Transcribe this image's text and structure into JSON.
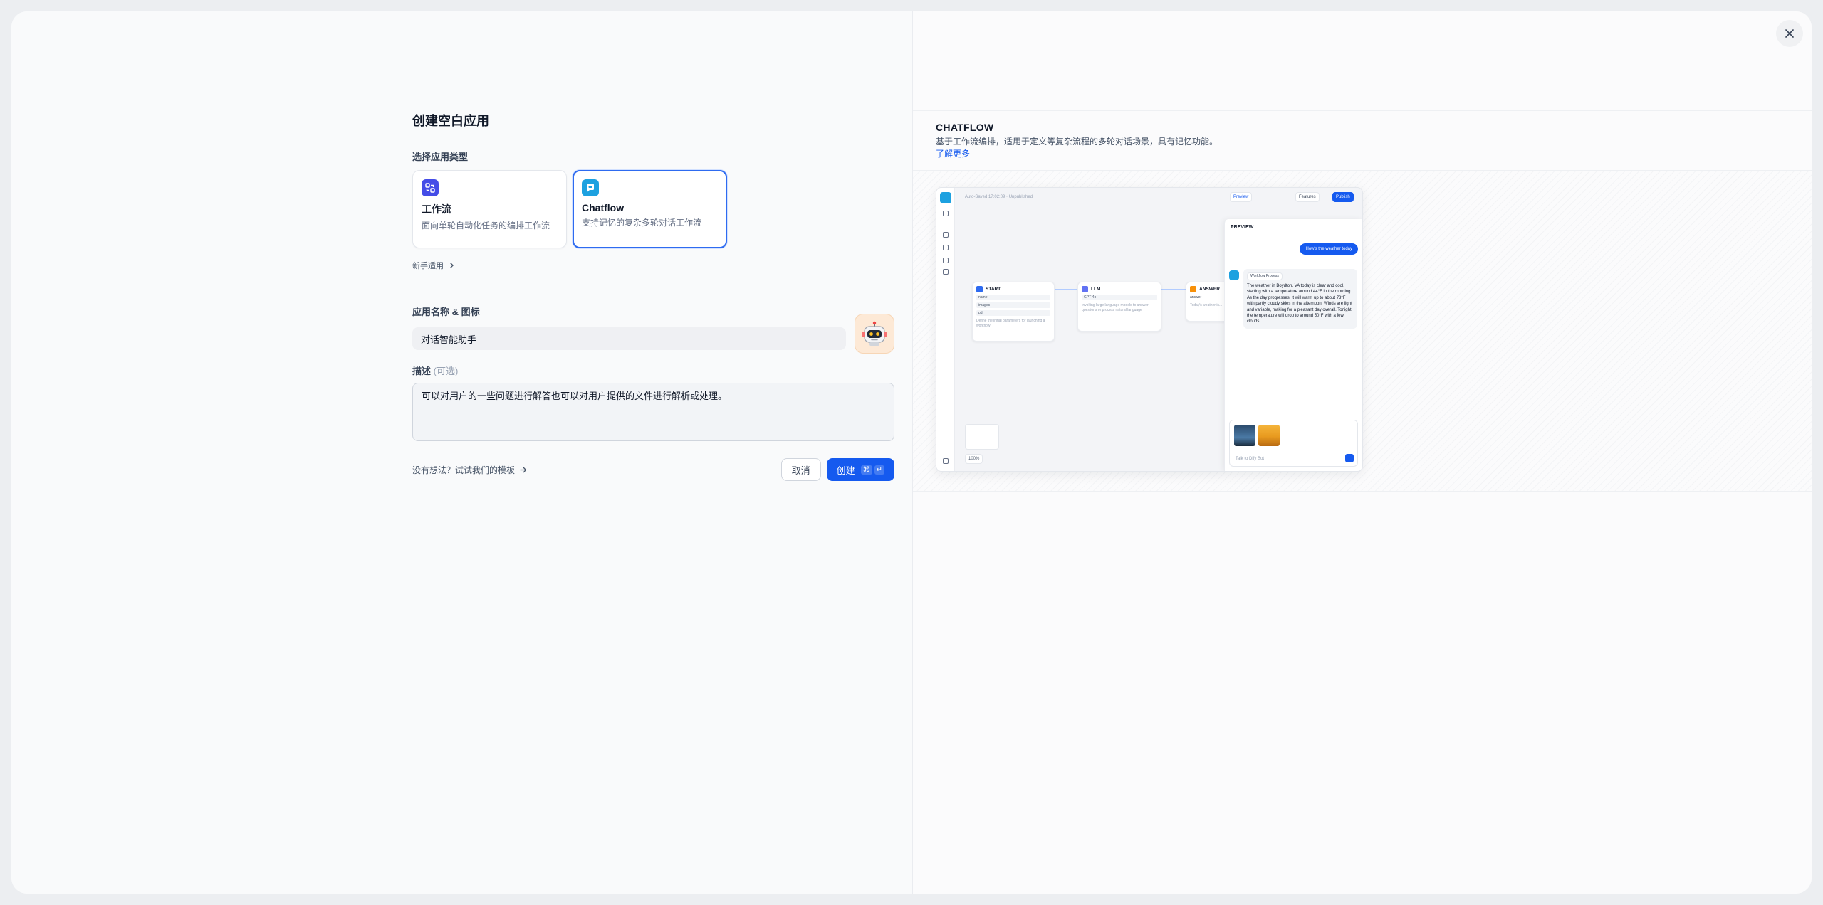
{
  "dialog": {
    "title": "创建空白应用",
    "app_type_label": "选择应用类型",
    "app_types": [
      {
        "name": "工作流",
        "desc": "面向单轮自动化任务的编排工作流",
        "icon": "workflow-icon",
        "color": "#444ce7",
        "selected": false
      },
      {
        "name": "Chatflow",
        "desc": "支持记忆的复杂多轮对话工作流",
        "icon": "chatflow-icon",
        "color": "#1da1e0",
        "selected": true
      }
    ],
    "beginner_link": "新手适用",
    "name_icon_label": "应用名称 & 图标",
    "name_value": "对话智能助手",
    "avatar_icon": "robot-icon",
    "description_label": "描述",
    "description_optional": "(可选)",
    "description_value": "可以对用户的一些问题进行解答也可以对用户提供的文件进行解析或处理。",
    "template_link": "没有想法？试试我们的模板",
    "cancel_label": "取消",
    "create_label": "创建",
    "create_shortcut": [
      "⌘",
      "↵"
    ]
  },
  "preview": {
    "title": "CHATFLOW",
    "desc": "基于工作流编排，适用于定义等复杂流程的多轮对话场景，具有记忆功能。",
    "learn_more": "了解更多",
    "screenshot": {
      "autosave": "Auto-Saved 17:02:09 · Unpublished",
      "preview_btn": "Preview",
      "features_btn": "Features",
      "publish_btn": "Publish",
      "nodes": {
        "start": {
          "title": "START",
          "rows": [
            "name",
            "images",
            "pdf"
          ],
          "note": "Define the initial parameters for launching a workflow"
        },
        "llm": {
          "title": "LLM",
          "model": "GPT-4o",
          "note": "Invoking large language models to answer questions or process natural language"
        },
        "answer": {
          "title": "ANSWER",
          "field": "answer",
          "note": "Today's weather is..."
        }
      },
      "panel": {
        "title": "PREVIEW",
        "user_msg": "How's the weather today",
        "workflow_tag": "Workflow Process",
        "answer": "The weather in Boydton, VA today is clear and cool, starting with a temperature around 44°F in the morning. As the day progresses, it will warm up to about 73°F with partly cloudy skies in the afternoon. Winds are light and variable, making for a pleasant day overall. Tonight, the temperature will drop to around 50°F with a few clouds.",
        "input_placeholder": "Talk to Dify Bot",
        "zoom": "100%"
      }
    }
  }
}
